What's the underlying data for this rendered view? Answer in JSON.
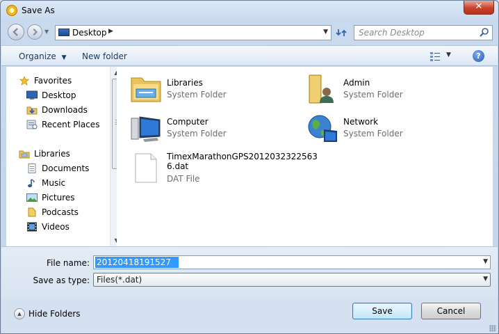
{
  "window": {
    "title": "Save As",
    "close_label": "✕"
  },
  "nav": {
    "address": "Desktop",
    "search_placeholder": "Search Desktop"
  },
  "toolbar": {
    "organize_label": "Organize",
    "new_folder_label": "New folder",
    "help_label": "?"
  },
  "sidebar": {
    "groups": [
      {
        "label": "Favorites",
        "icon": "star-icon",
        "items": [
          {
            "label": "Desktop",
            "icon": "desktop-icon"
          },
          {
            "label": "Downloads",
            "icon": "downloads-icon"
          },
          {
            "label": "Recent Places",
            "icon": "recent-places-icon"
          }
        ]
      },
      {
        "label": "Libraries",
        "icon": "libraries-icon",
        "items": [
          {
            "label": "Documents",
            "icon": "documents-icon"
          },
          {
            "label": "Music",
            "icon": "music-icon"
          },
          {
            "label": "Pictures",
            "icon": "pictures-icon"
          },
          {
            "label": "Podcasts",
            "icon": "podcasts-icon"
          },
          {
            "label": "Videos",
            "icon": "videos-icon"
          }
        ]
      }
    ]
  },
  "items": [
    {
      "name": "Libraries",
      "type": "System Folder",
      "icon": "libraries-folder-icon"
    },
    {
      "name": "Admin",
      "type": "System Folder",
      "icon": "user-folder-icon"
    },
    {
      "name": "Computer",
      "type": "System Folder",
      "icon": "computer-icon"
    },
    {
      "name": "Network",
      "type": "System Folder",
      "icon": "network-icon"
    },
    {
      "name_line1": "TimexMarathonGPS2012032322563",
      "name_line2": "6.dat",
      "type": "DAT File",
      "icon": "file-icon"
    }
  ],
  "form": {
    "file_name_label": "File name:",
    "file_name_value": "20120418191527",
    "save_type_label": "Save as type:",
    "save_type_value": "Files(*.dat)"
  },
  "footer": {
    "hide_folders_label": "Hide Folders",
    "save_label": "Save",
    "cancel_label": "Cancel"
  },
  "colors": {
    "selection": "#3399ff",
    "window_frame": "#c4d5ec",
    "close": "#c7422b"
  }
}
